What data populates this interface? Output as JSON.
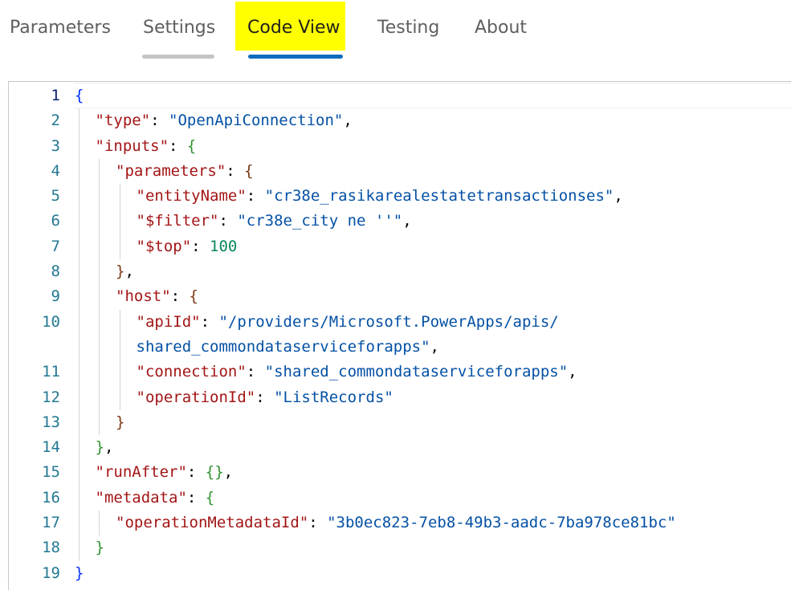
{
  "tabs": [
    {
      "label": "Parameters",
      "selected": false
    },
    {
      "label": "Settings",
      "selected": false
    },
    {
      "label": "Code View",
      "selected": true
    },
    {
      "label": "Testing",
      "selected": false
    },
    {
      "label": "About",
      "selected": false
    }
  ],
  "code": {
    "lines": [
      {
        "num": "1",
        "indent": 0,
        "tokens": [
          {
            "t": "{",
            "c": "b1"
          }
        ]
      },
      {
        "num": "2",
        "indent": 1,
        "tokens": [
          {
            "t": "\"type\"",
            "c": "k"
          },
          {
            "t": ": ",
            "c": "p"
          },
          {
            "t": "\"OpenApiConnection\"",
            "c": "s"
          },
          {
            "t": ",",
            "c": "p"
          }
        ]
      },
      {
        "num": "3",
        "indent": 1,
        "tokens": [
          {
            "t": "\"inputs\"",
            "c": "k"
          },
          {
            "t": ": ",
            "c": "p"
          },
          {
            "t": "{",
            "c": "b2"
          }
        ]
      },
      {
        "num": "4",
        "indent": 2,
        "tokens": [
          {
            "t": "\"parameters\"",
            "c": "k"
          },
          {
            "t": ": ",
            "c": "p"
          },
          {
            "t": "{",
            "c": "b3"
          }
        ]
      },
      {
        "num": "5",
        "indent": 3,
        "tokens": [
          {
            "t": "\"entityName\"",
            "c": "k"
          },
          {
            "t": ": ",
            "c": "p"
          },
          {
            "t": "\"cr38e_rasikarealestatetransactionses\"",
            "c": "s"
          },
          {
            "t": ",",
            "c": "p"
          }
        ]
      },
      {
        "num": "6",
        "indent": 3,
        "tokens": [
          {
            "t": "\"$filter\"",
            "c": "k"
          },
          {
            "t": ": ",
            "c": "p"
          },
          {
            "t": "\"cr38e_city ne ''\"",
            "c": "s"
          },
          {
            "t": ",",
            "c": "p"
          }
        ]
      },
      {
        "num": "7",
        "indent": 3,
        "tokens": [
          {
            "t": "\"$top\"",
            "c": "k"
          },
          {
            "t": ": ",
            "c": "p"
          },
          {
            "t": "100",
            "c": "n"
          }
        ]
      },
      {
        "num": "8",
        "indent": 2,
        "tokens": [
          {
            "t": "}",
            "c": "b3"
          },
          {
            "t": ",",
            "c": "p"
          }
        ]
      },
      {
        "num": "9",
        "indent": 2,
        "tokens": [
          {
            "t": "\"host\"",
            "c": "k"
          },
          {
            "t": ": ",
            "c": "p"
          },
          {
            "t": "{",
            "c": "b3"
          }
        ]
      },
      {
        "num": "10",
        "indent": 3,
        "tokens": [
          {
            "t": "\"apiId\"",
            "c": "k"
          },
          {
            "t": ": ",
            "c": "p"
          },
          {
            "t": "\"/providers/Microsoft.PowerApps/apis/",
            "c": "s"
          }
        ]
      },
      {
        "num": "",
        "indent": 3,
        "tokens": [
          {
            "t": "shared_commondataserviceforapps\"",
            "c": "s"
          },
          {
            "t": ",",
            "c": "p"
          }
        ]
      },
      {
        "num": "11",
        "indent": 3,
        "tokens": [
          {
            "t": "\"connection\"",
            "c": "k"
          },
          {
            "t": ": ",
            "c": "p"
          },
          {
            "t": "\"shared_commondataserviceforapps\"",
            "c": "s"
          },
          {
            "t": ",",
            "c": "p"
          }
        ]
      },
      {
        "num": "12",
        "indent": 3,
        "tokens": [
          {
            "t": "\"operationId\"",
            "c": "k"
          },
          {
            "t": ": ",
            "c": "p"
          },
          {
            "t": "\"ListRecords\"",
            "c": "s"
          }
        ]
      },
      {
        "num": "13",
        "indent": 2,
        "tokens": [
          {
            "t": "}",
            "c": "b3"
          }
        ]
      },
      {
        "num": "14",
        "indent": 1,
        "tokens": [
          {
            "t": "}",
            "c": "b2"
          },
          {
            "t": ",",
            "c": "p"
          }
        ]
      },
      {
        "num": "15",
        "indent": 1,
        "tokens": [
          {
            "t": "\"runAfter\"",
            "c": "k"
          },
          {
            "t": ": ",
            "c": "p"
          },
          {
            "t": "{}",
            "c": "b2"
          },
          {
            "t": ",",
            "c": "p"
          }
        ]
      },
      {
        "num": "16",
        "indent": 1,
        "tokens": [
          {
            "t": "\"metadata\"",
            "c": "k"
          },
          {
            "t": ": ",
            "c": "p"
          },
          {
            "t": "{",
            "c": "b2"
          }
        ]
      },
      {
        "num": "17",
        "indent": 2,
        "tokens": [
          {
            "t": "\"operationMetadataId\"",
            "c": "k"
          },
          {
            "t": ": ",
            "c": "p"
          },
          {
            "t": "\"3b0ec823-7eb8-49b3-aadc-7ba978ce81bc\"",
            "c": "s"
          }
        ]
      },
      {
        "num": "18",
        "indent": 1,
        "tokens": [
          {
            "t": "}",
            "c": "b2"
          }
        ]
      },
      {
        "num": "19",
        "indent": 0,
        "tokens": [
          {
            "t": "}",
            "c": "b1"
          }
        ]
      }
    ]
  },
  "colors": {
    "accent_underline": "#0f6cbd",
    "highlight": "#ffff00",
    "json_key": "#a31515",
    "json_string": "#0451a5",
    "json_number": "#098658",
    "line_number": "#237893"
  }
}
